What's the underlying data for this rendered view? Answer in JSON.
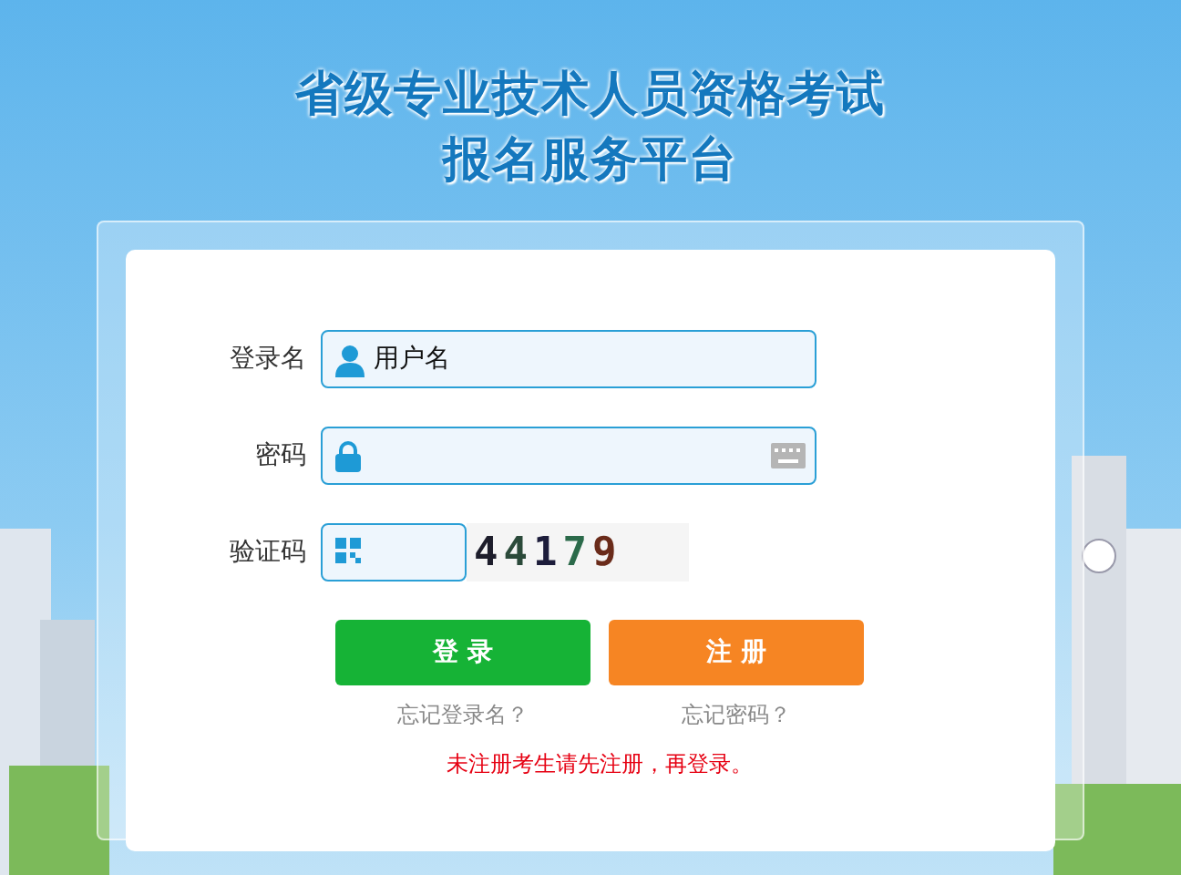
{
  "header": {
    "title_lines": [
      "省级专业技术人员资格考试",
      "报名服务平台"
    ]
  },
  "form": {
    "fields": [
      {
        "kind": "username",
        "label": "登录名",
        "value": "用户名"
      },
      {
        "kind": "password",
        "label": "密码"
      },
      {
        "kind": "captcha",
        "label": "验证码",
        "captcha": "44179"
      }
    ],
    "buttons": [
      {
        "kind": "login",
        "label": "登 录"
      },
      {
        "kind": "register",
        "label": "注 册"
      }
    ],
    "links": [
      "忘记登录名？",
      "忘记密码？"
    ],
    "notice": "未注册考生请先注册，再登录。"
  }
}
